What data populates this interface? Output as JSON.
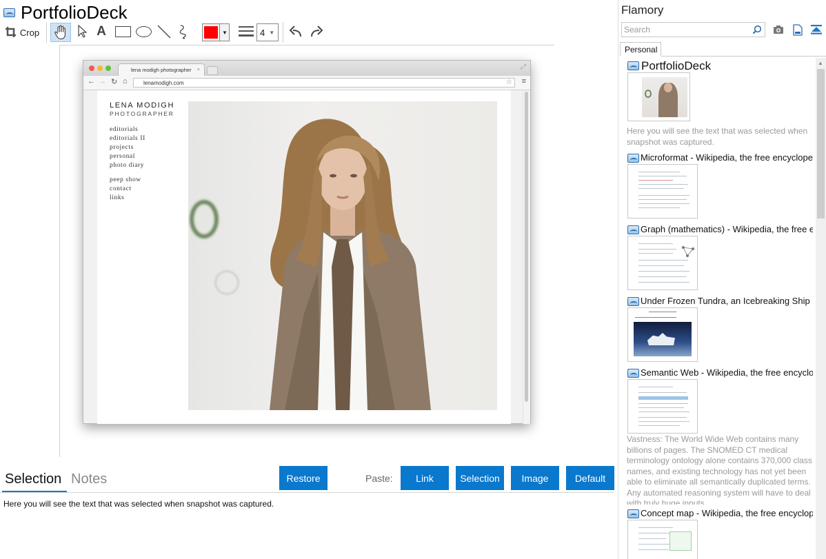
{
  "window": {
    "title": "PortfolioDeck"
  },
  "toolbar": {
    "crop_label": "Crop",
    "text_tool_glyph": "A",
    "stroke_width": "4",
    "color": "#ff0000"
  },
  "browser": {
    "tab_title": "lena modigh photographer",
    "url": "lenamodigh.com",
    "site_title": "LENA MODIGH",
    "site_subtitle": "PHOTOGRAPHER",
    "menu_1": [
      "editorials",
      "editorials II",
      "projects",
      "personal",
      "photo diary"
    ],
    "menu_2": [
      "peep show",
      "contact",
      "links"
    ]
  },
  "bottom": {
    "tab_selection": "Selection",
    "tab_notes": "Notes",
    "restore_label": "Restore",
    "paste_label": "Paste:",
    "paste_link": "Link",
    "paste_selection": "Selection",
    "paste_image": "Image",
    "paste_default": "Default",
    "selection_text": "Here you will see the text that was selected when snapshot was captured."
  },
  "sidebar": {
    "app_name": "Flamory",
    "search_placeholder": "Search",
    "tab_personal": "Personal",
    "entries": [
      {
        "title": "PortfolioDeck",
        "note": "Here you will see the text that was selected when snapshot was captured."
      },
      {
        "title": "Microformat - Wikipedia, the free encyclopedia"
      },
      {
        "title": "Graph (mathematics) - Wikipedia, the free ency"
      },
      {
        "title": "Under Frozen Tundra, an Icebreaking Ship Unco"
      },
      {
        "title": "Semantic Web - Wikipedia, the free encycloped",
        "note": "Vastness: The World Wide Web contains many billions of pages. The SNOMED CT medical terminology ontology alone contains 370,000 class names, and existing technology has not yet been able to eliminate all semantically duplicated terms. Any automated reasoning system will have to deal with truly huge inputs."
      },
      {
        "title": "Concept map - Wikipedia, the free encyclopedi"
      }
    ]
  },
  "colors": {
    "accent": "#0a78cd",
    "annotation": "#ff0000"
  }
}
